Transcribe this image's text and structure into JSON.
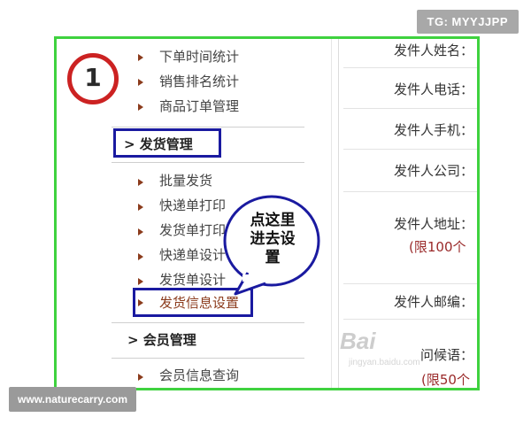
{
  "tags": {
    "top": "TG: MYYJJPP",
    "bottom": "www.naturecarry.com"
  },
  "step_number": "1",
  "sidebar": {
    "top_items": [
      "下单时间统计",
      "销售排名统计",
      "商品订单管理"
    ],
    "shipping_header": "> 发货管理",
    "shipping_items": [
      "批量发货",
      "快递单打印",
      "发货单打印",
      "快递单设计",
      "发货单设计",
      "发货信息设置"
    ],
    "member_header": "> 会员管理",
    "member_items": [
      "会员信息查询"
    ]
  },
  "callout": {
    "line1": "点这里",
    "line2": "进去设",
    "line3": "置"
  },
  "form": {
    "fields": [
      "发件人姓名：",
      "发件人电话：",
      "发件人手机：",
      "发件人公司：",
      "发件人地址：",
      "发件人邮编：",
      "问候语："
    ],
    "address_note": "(限100个",
    "greeting_note": "(限50个"
  },
  "watermark": {
    "logo": "Bai",
    "sub": "jingyan.baidu.com"
  }
}
